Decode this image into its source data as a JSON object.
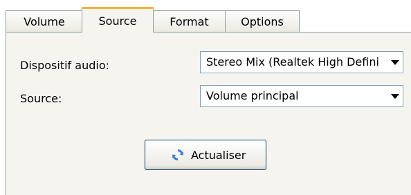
{
  "tabs": [
    {
      "label": "Volume"
    },
    {
      "label": "Source"
    },
    {
      "label": "Format"
    },
    {
      "label": "Options"
    }
  ],
  "active_tab": "Source",
  "form": {
    "device_label": "Dispositif audio:",
    "device_value": "Stereo Mix (Realtek High Definition Audio)",
    "source_label": "Source:",
    "source_value": "Volume principal"
  },
  "actions": {
    "refresh_label": "Actualiser",
    "refresh_icon": "refresh-icon"
  },
  "colors": {
    "active_tab_accent": "#f5b23b",
    "refresh_icon": "#3a7fd5"
  }
}
